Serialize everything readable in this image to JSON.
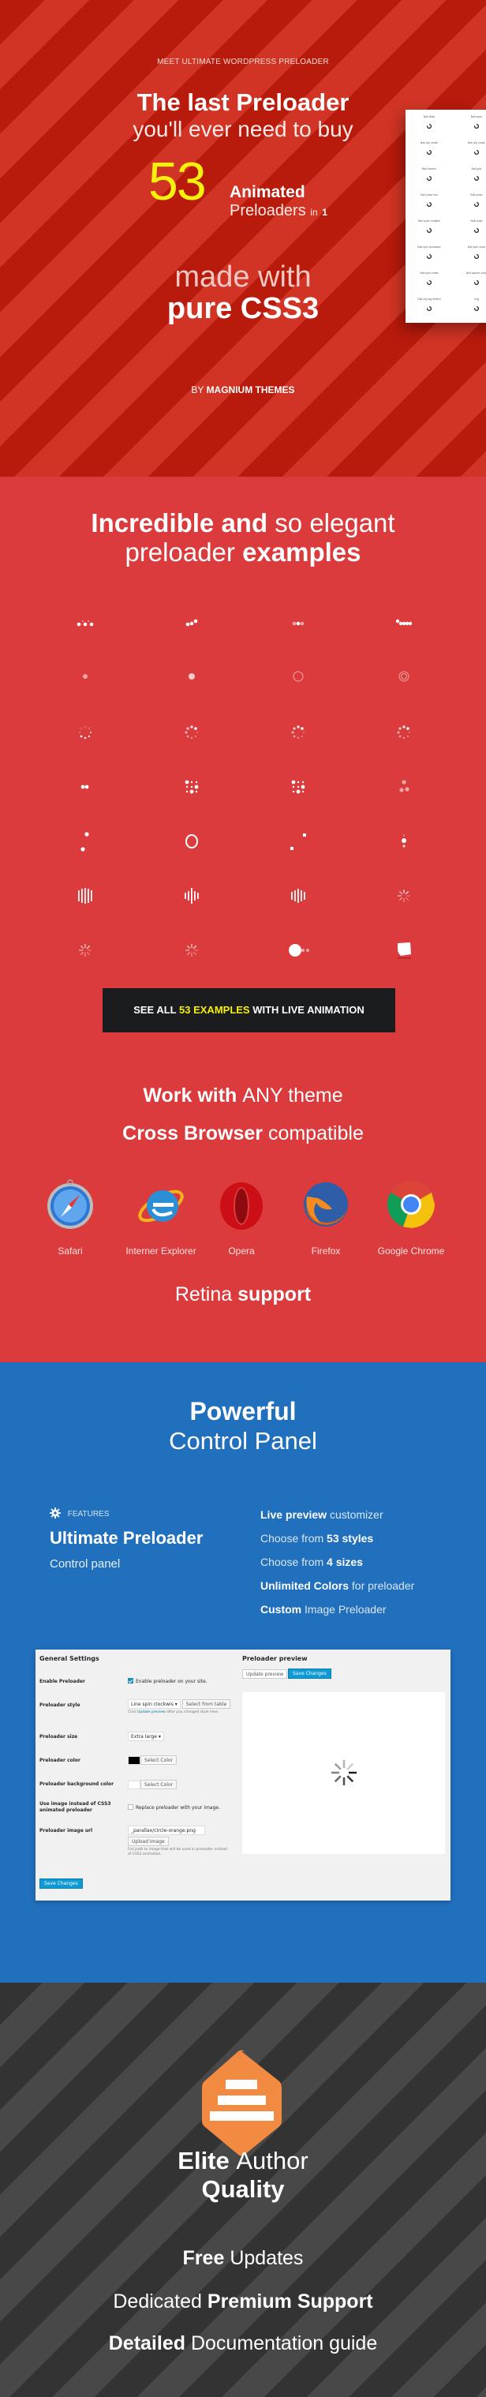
{
  "hero": {
    "kicker": "MEET ULTIMATE WORDPRESS PRELOADER",
    "headline_bold": "The last Preloader",
    "headline_light": "you'll ever need to buy",
    "count": "53",
    "animated": "Animated",
    "preloaders": "Preloaders",
    "in_word": "in",
    "one": "1",
    "made_with": "made with",
    "pure_css3": "pure CSS3",
    "by_prefix": "BY",
    "by_author": "MAGNIUM THEMES",
    "card_items": [
      {
        "label": "Ball 8bits",
        "icon": "ball-8bits"
      },
      {
        "label": "Ball atom",
        "icon": "ball-atom"
      },
      {
        "label": "Ball clip rotate",
        "icon": "ball-clip-rotate"
      },
      {
        "label": "Ball clip rotate",
        "icon": "ball-clip-rotate-alt"
      },
      {
        "label": "Ball fussion",
        "icon": "ball-fussion"
      },
      {
        "label": "Ball grid",
        "icon": "ball-grid"
      },
      {
        "label": "Ball pulse rise",
        "icon": "ball-pulse-rise"
      },
      {
        "label": "Ball pulse",
        "icon": "ball-pulse"
      },
      {
        "label": "Ball scale multiple",
        "icon": "ball-scale-multiple"
      },
      {
        "label": "Ball scale",
        "icon": "ball-scale"
      },
      {
        "label": "Ball spin clockwise",
        "icon": "ball-spin-clockwise"
      },
      {
        "label": "Ball spin clock",
        "icon": "ball-spin-clock"
      },
      {
        "label": "Ball spin rotate",
        "icon": "ball-spin-rotate"
      },
      {
        "label": "Ball square clock",
        "icon": "ball-square-clock"
      },
      {
        "label": "Ball zig zag deflect",
        "icon": "ball-zig-zag-deflect"
      },
      {
        "label": "Cog",
        "icon": "cog"
      }
    ]
  },
  "examples": {
    "title_bold": "Incredible and",
    "title_light": "so elegant",
    "title2_light": "preloader",
    "title2_bold": "examples",
    "grid": [
      "ball-pulse-rise",
      "ball-pulse-sync",
      "ball-pulse",
      "ball-beat",
      "ball-scale",
      "ball-scale-fade",
      "ball-scale-ripple",
      "ball-scale-ripple-multiple",
      "ball-spin",
      "ball-spin-fade",
      "ball-spin-clockwise",
      "ball-spin-clockwise-fade",
      "ball-zig-zag",
      "ball-grid-pulse",
      "ball-grid-beat",
      "ball-triangle-path",
      "ball-zig-zag-deflect",
      "ball-clip-rotate",
      "square-spin-pair",
      "ball-clip-rotate-pulse",
      "line-scale",
      "line-scale-party",
      "line-scale-pulse-out",
      "line-spin-fade",
      "line-spin-clockwise",
      "line-spin-clockwise-fade",
      "pacman",
      "cube-transition"
    ],
    "button_prefix": "SEE ALL",
    "button_highlight": "53 EXAMPLES",
    "button_suffix": "WITH LIVE ANIMATION",
    "work_bold": "Work with",
    "work_light": "ANY theme",
    "cross_bold": "Cross Browser",
    "cross_light": "compatible",
    "browsers": [
      {
        "name": "Safari",
        "icon": "safari-icon"
      },
      {
        "name": "Interner Explorer",
        "icon": "internet-explorer-icon"
      },
      {
        "name": "Opera",
        "icon": "opera-icon"
      },
      {
        "name": "Firefox",
        "icon": "firefox-icon"
      },
      {
        "name": "Google Chrome",
        "icon": "chrome-icon"
      }
    ],
    "retina_light": "Retina",
    "retina_bold": "support"
  },
  "panel": {
    "title_bold": "Powerful",
    "title_light": "Control Panel",
    "features_tag": "FEATURES",
    "product_title": "Ultimate Preloader",
    "product_sub": "Control panel",
    "features": [
      {
        "bold": "Live preview",
        "light": "customizer",
        "bold_first": true
      },
      {
        "bold": "53 styles",
        "light": "Choose from",
        "bold_first": false
      },
      {
        "bold": "4 sizes",
        "light": "Choose from",
        "bold_first": false
      },
      {
        "bold": "Unlimited Colors",
        "light": "for preloader",
        "bold_first": true
      },
      {
        "bold": "Custom",
        "light": "Image Preloader",
        "bold_first": true
      }
    ],
    "settings": {
      "heading": "General Settings",
      "enable_label": "Enable Preloader",
      "enable_text": "Enable preloader on your site.",
      "enable_checked": true,
      "style_label": "Preloader style",
      "style_value": "Line spin clockwis",
      "style_table_btn": "Select from table",
      "style_hint_pre": "Click",
      "style_hint_link": "Update preview",
      "style_hint_post": "after you changed style here.",
      "size_label": "Preloader size",
      "size_value": "Extra large",
      "color_label": "Preloader color",
      "color_value": "#000000",
      "color_btn": "Select Color",
      "bg_label": "Preloader background color",
      "bg_value": "#ffffff",
      "bg_btn": "Select Color",
      "image_label": "Use image instead of CSS3 animated preloader",
      "image_text": "Replace preloader with your image.",
      "image_checked": false,
      "url_label": "Preloader image url",
      "url_value": "_parallax/circle-orange.png",
      "upload_btn": "Upload Image",
      "url_hint": "Full path to image that will be used in preloader instead of CSS3 animation.",
      "save_btn": "Save Changes"
    },
    "preview": {
      "heading": "Preloader preview",
      "update_btn": "Update preview",
      "save_btn": "Save Changes"
    }
  },
  "elite": {
    "elite_bold": "Elite",
    "elite_light": "Author",
    "quality": "Quality",
    "lines": [
      {
        "bold": "Free",
        "light": "Updates",
        "bold_first": true
      },
      {
        "bold": "Premium Support",
        "light": "Dedicated",
        "bold_first": false
      },
      {
        "bold": "Detailed",
        "light": "Documentation guide",
        "bold_first": true
      }
    ]
  },
  "colors": {
    "hero_red": "#b81a0c",
    "section_red": "#db3b3d",
    "panel_blue": "#2170bd",
    "accent_yellow": "#f5f10c",
    "elite_orange": "#f28a42",
    "button_dark": "#1b1c1e"
  }
}
